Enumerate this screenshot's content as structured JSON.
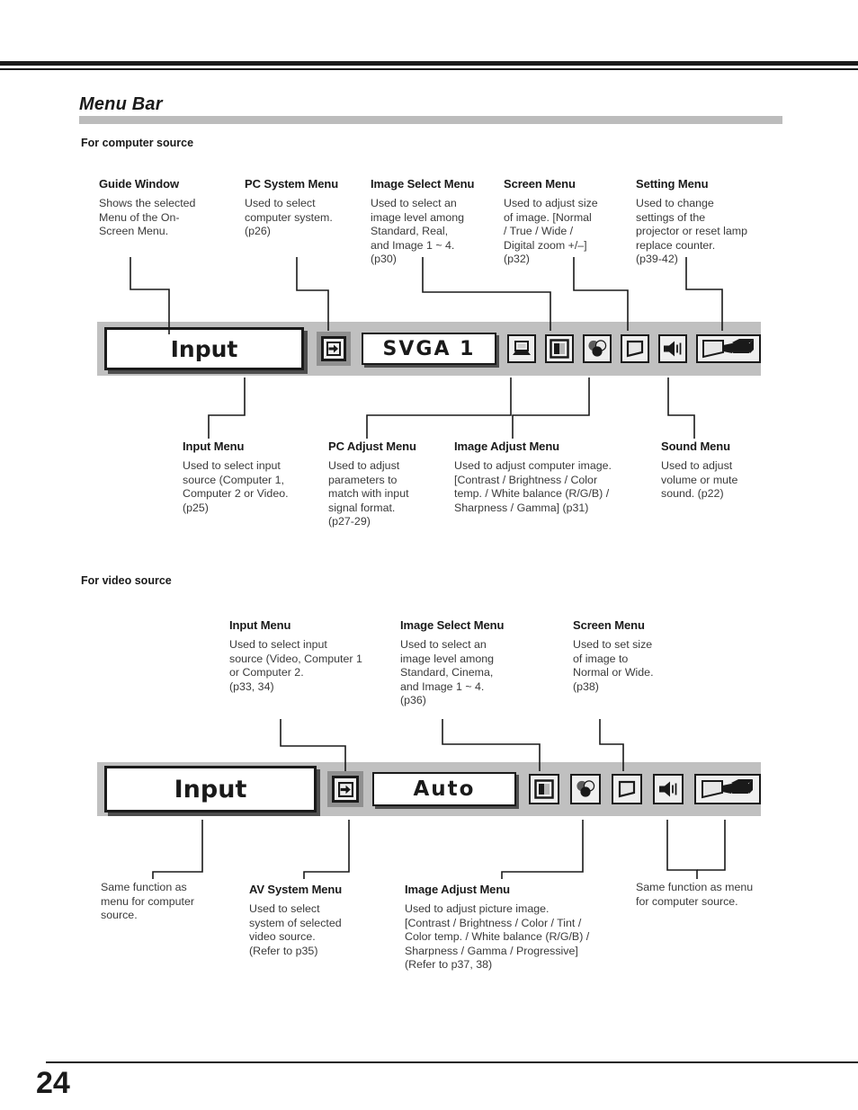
{
  "page": {
    "number": "24",
    "section_title": "Menu Bar"
  },
  "computer_section": {
    "heading": "For computer source",
    "top_callouts": [
      {
        "title": "Guide Window",
        "body": "Shows the selected\nMenu of the On-\nScreen Menu."
      },
      {
        "title": "PC System Menu",
        "body": "Used to select\ncomputer system.\n(p26)"
      },
      {
        "title": "Image Select Menu",
        "body": "Used to select  an\nimage level among\nStandard, Real,\nand Image 1 ~ 4.\n(p30)"
      },
      {
        "title": "Screen Menu",
        "body": "Used to adjust size\nof image.  [Normal\n/ True / Wide /\nDigital zoom +/–]\n(p32)"
      },
      {
        "title": "Setting Menu",
        "body": "Used to change\nsettings of the\nprojector or reset  lamp\nreplace counter.\n(p39-42)"
      }
    ],
    "bottom_callouts": [
      {
        "title": "Input Menu",
        "body": "Used to select input\nsource (Computer 1,\nComputer 2 or Video.\n(p25)"
      },
      {
        "title": "PC Adjust Menu",
        "body": "Used to adjust\nparameters to\nmatch with input\nsignal format.\n(p27-29)"
      },
      {
        "title": "Image Adjust Menu",
        "body": "Used to adjust computer image.\n[Contrast / Brightness / Color\ntemp. /  White balance (R/G/B) /\nSharpness /  Gamma]   (p31)"
      },
      {
        "title": "Sound Menu",
        "body": "Used to adjust\nvolume or mute\nsound.  (p22)"
      }
    ],
    "menubar": {
      "guide_window_label": "Input",
      "selector_icon": "input-arrow-icon",
      "system_window_label": "SVGA 1",
      "icons": [
        {
          "name": "pc-adjust-icon",
          "label": "PC Adjust Menu"
        },
        {
          "name": "image-select-icon",
          "label": "Image Select Menu"
        },
        {
          "name": "image-adjust-icon",
          "label": "Image Adjust Menu"
        },
        {
          "name": "screen-icon",
          "label": "Screen Menu"
        },
        {
          "name": "sound-icon",
          "label": "Sound Menu"
        },
        {
          "name": "setting-icon",
          "label": "Setting Menu"
        }
      ]
    }
  },
  "video_section": {
    "heading": "For video source",
    "top_callouts": [
      {
        "title": "Input Menu",
        "body": "Used to select input\nsource (Video, Computer 1\nor Computer 2.\n(p33, 34)"
      },
      {
        "title": "Image Select Menu",
        "body": "Used to select an\nimage level among\nStandard, Cinema,\nand Image 1 ~ 4.\n(p36)"
      },
      {
        "title": "Screen Menu",
        "body": "Used to set size\nof image to\nNormal or Wide.\n(p38)"
      }
    ],
    "bottom_callouts": [
      {
        "title": "",
        "body": "Same function as\nmenu for computer\nsource."
      },
      {
        "title": "AV System Menu",
        "body": "Used to select\nsystem of selected\nvideo source.\n(Refer to p35)"
      },
      {
        "title": "Image Adjust Menu",
        "body": " Used to adjust picture image.\n[Contrast / Brightness / Color / Tint /\nColor temp. / White balance (R/G/B) /\nSharpness /  Gamma / Progressive]\n (Refer to p37, 38)"
      },
      {
        "title": "",
        "body": "Same function as menu\nfor computer source."
      }
    ],
    "menubar": {
      "guide_window_label": "Input",
      "selector_icon": "input-arrow-icon",
      "system_window_label": "Auto",
      "icons": [
        {
          "name": "image-select-icon",
          "label": "Image Select Menu"
        },
        {
          "name": "image-adjust-icon",
          "label": "Image Adjust Menu"
        },
        {
          "name": "screen-icon",
          "label": "Screen Menu"
        },
        {
          "name": "sound-icon",
          "label": "Sound Menu"
        },
        {
          "name": "setting-icon",
          "label": "Setting Menu"
        }
      ]
    }
  },
  "colors": {
    "menubar_bg": "#c0c0c0",
    "rule": "#1a1a1a",
    "section_bar": "#bcbcbc",
    "body_text": "#3a3a3a"
  }
}
